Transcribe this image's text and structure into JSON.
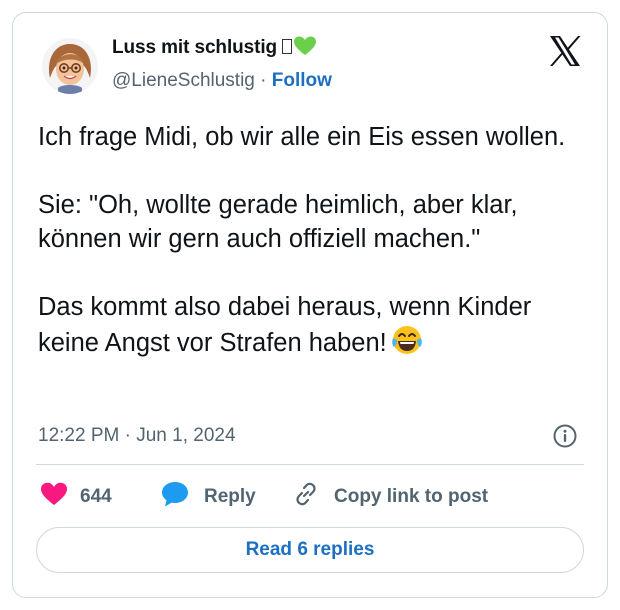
{
  "author": {
    "display_name": "Luss mit schlustig",
    "handle": "@LieneSchlustig",
    "separator": "·",
    "follow_label": "Follow"
  },
  "tweet": {
    "paragraphs": [
      "Ich frage Midi, ob wir alle ein Eis essen wollen.",
      "Sie: \"Oh, wollte gerade heimlich, aber klar, können wir gern auch offiziell machen.\"",
      "Das kommt also dabei heraus, wenn Kinder keine Angst vor Strafen haben!"
    ],
    "timestamp": "12:22 PM · Jun 1, 2024"
  },
  "actions": {
    "like_count": "644",
    "reply_label": "Reply",
    "copy_link_label": "Copy link to post"
  },
  "read_replies_label": "Read 6 replies",
  "icons": {
    "brand": "x-logo-icon",
    "like": "heart-icon",
    "reply": "speech-bubble-icon",
    "copy": "link-icon",
    "info": "info-icon",
    "emoji": "laughing-tears-emoji-icon"
  },
  "colors": {
    "link_blue": "#1d6fc1",
    "like_pink": "#f91880",
    "reply_blue": "#1d9bf0",
    "muted_text": "#536471",
    "border": "#cfd9de"
  }
}
